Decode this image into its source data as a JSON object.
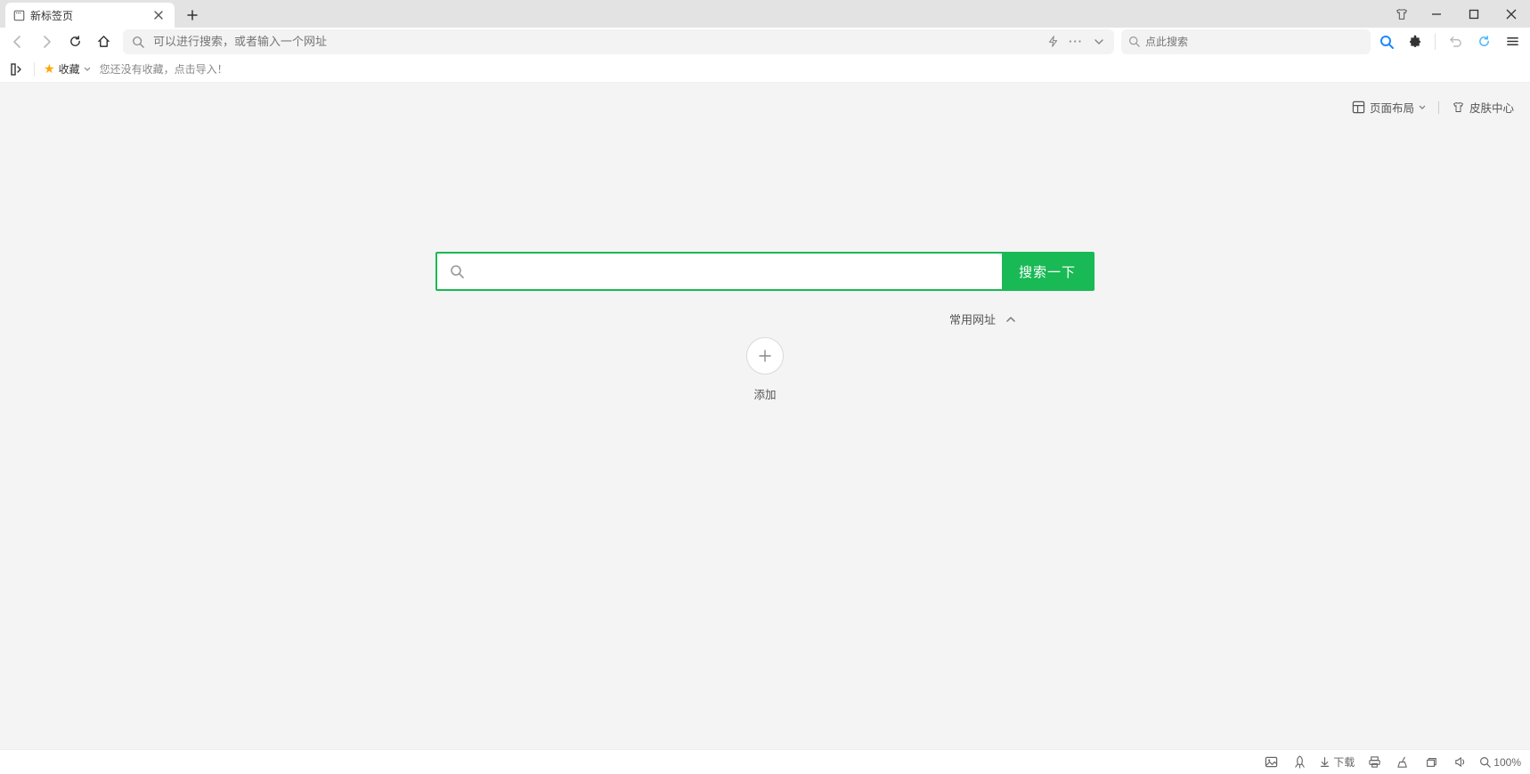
{
  "tab": {
    "title": "新标签页"
  },
  "omnibox": {
    "placeholder": "可以进行搜索，或者输入一个网址"
  },
  "mini_search": {
    "placeholder": "点此搜索"
  },
  "bookmarks": {
    "label": "收藏",
    "tip": "您还没有收藏，点击导入！"
  },
  "page_controls": {
    "layout": "页面布局",
    "skin": "皮肤中心"
  },
  "search": {
    "button": "搜索一下"
  },
  "freq": {
    "label": "常用网址"
  },
  "tile_add": "添加",
  "status": {
    "download": "下载",
    "zoom": "100%"
  }
}
